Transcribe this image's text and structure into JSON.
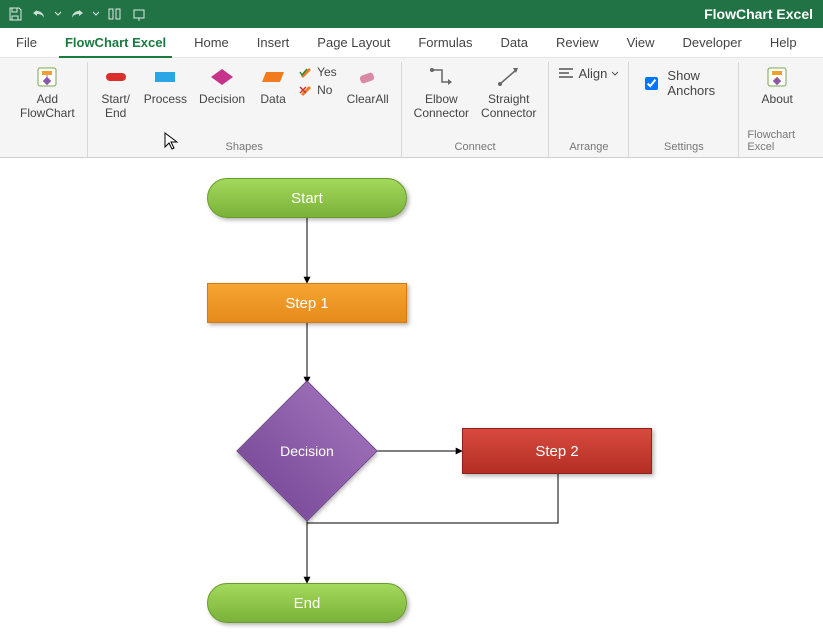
{
  "app_title": "FlowChart Excel",
  "tabs": [
    "File",
    "FlowChart Excel",
    "Home",
    "Insert",
    "Page Layout",
    "Formulas",
    "Data",
    "Review",
    "View",
    "Developer",
    "Help"
  ],
  "active_tab_index": 1,
  "ribbon": {
    "groups": [
      {
        "label": "",
        "items": [
          {
            "name": "add-flowchart",
            "label": "Add\nFlowChart"
          }
        ]
      },
      {
        "label": "Shapes",
        "items": [
          {
            "name": "start-end",
            "label": "Start/\nEnd",
            "color": "#d9302c"
          },
          {
            "name": "process",
            "label": "Process",
            "color": "#2aa6e6"
          },
          {
            "name": "decision",
            "label": "Decision",
            "color": "#c7338a"
          },
          {
            "name": "data",
            "label": "Data",
            "color": "#f07c1f"
          }
        ],
        "yesno": {
          "yes": "Yes",
          "no": "No"
        },
        "clearall": "ClearAll"
      },
      {
        "label": "Connect",
        "items": [
          {
            "name": "elbow-connector",
            "label": "Elbow\nConnector"
          },
          {
            "name": "straight-connector",
            "label": "Straight\nConnector"
          }
        ]
      },
      {
        "label": "Arrange",
        "align_label": "Align"
      },
      {
        "label": "Settings",
        "show_anchors": "Show Anchors"
      },
      {
        "label": "Flowchart Excel",
        "about": "About"
      }
    ]
  },
  "flowchart": {
    "start": "Start",
    "step1": "Step 1",
    "decision": "Decision",
    "step2": "Step 2",
    "end": "End"
  }
}
